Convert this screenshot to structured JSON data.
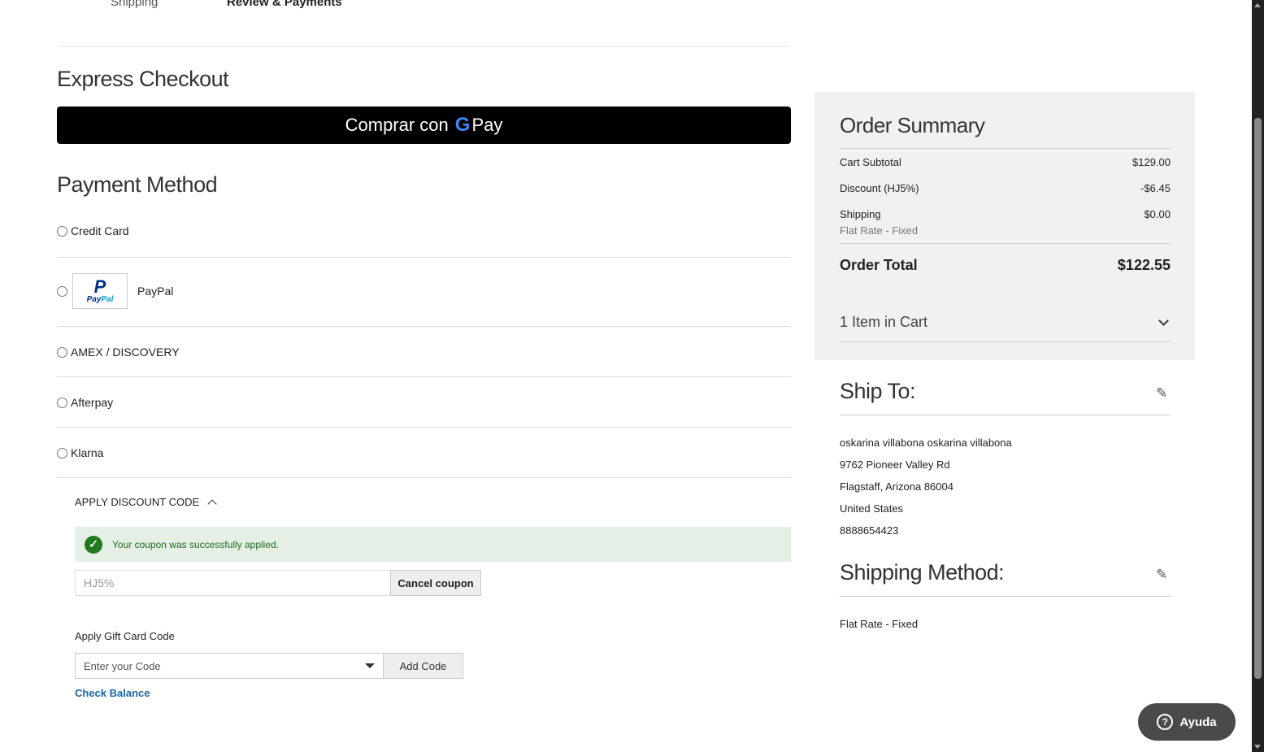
{
  "steps": [
    "Shipping",
    "Review & Payments"
  ],
  "express_title": "Express Checkout",
  "gpay": {
    "label": "Comprar con",
    "g": "G",
    "pay": "Pay"
  },
  "payment_title": "Payment Method",
  "methods": {
    "credit": "Credit Card",
    "paypal": "PayPal",
    "paypal_logo": {
      "p": "P",
      "text1": "Pay",
      "text2": "Pal"
    },
    "amex": "AMEX / DISCOVERY",
    "afterpay": "Afterpay",
    "klarna": "Klarna"
  },
  "discount": {
    "header": "APPLY DISCOUNT CODE",
    "success": "Your coupon was successfully applied.",
    "code_value": "HJ5%",
    "cancel": "Cancel coupon"
  },
  "gift": {
    "label": "Apply Gift Card Code",
    "placeholder": "Enter your Code",
    "add": "Add Code",
    "balance": "Check Balance"
  },
  "summary": {
    "title": "Order Summary",
    "subtotal_label": "Cart Subtotal",
    "subtotal": "$129.00",
    "discount_label": "Discount (HJ5%)",
    "discount": "-$6.45",
    "shipping_label": "Shipping",
    "shipping": "$0.00",
    "shipping_sub": "Flat Rate - Fixed",
    "total_label": "Order Total",
    "total": "$122.55",
    "items": "1 Item in Cart"
  },
  "ship_to": {
    "title": "Ship To:",
    "name": "oskarina villabona oskarina villabona",
    "street": "9762 Pioneer Valley Rd",
    "city": "Flagstaff, Arizona 86004",
    "country": "United States",
    "phone": "8888654423"
  },
  "shipping_method": {
    "title": "Shipping Method:",
    "value": "Flat Rate - Fixed"
  },
  "help": "Ayuda"
}
